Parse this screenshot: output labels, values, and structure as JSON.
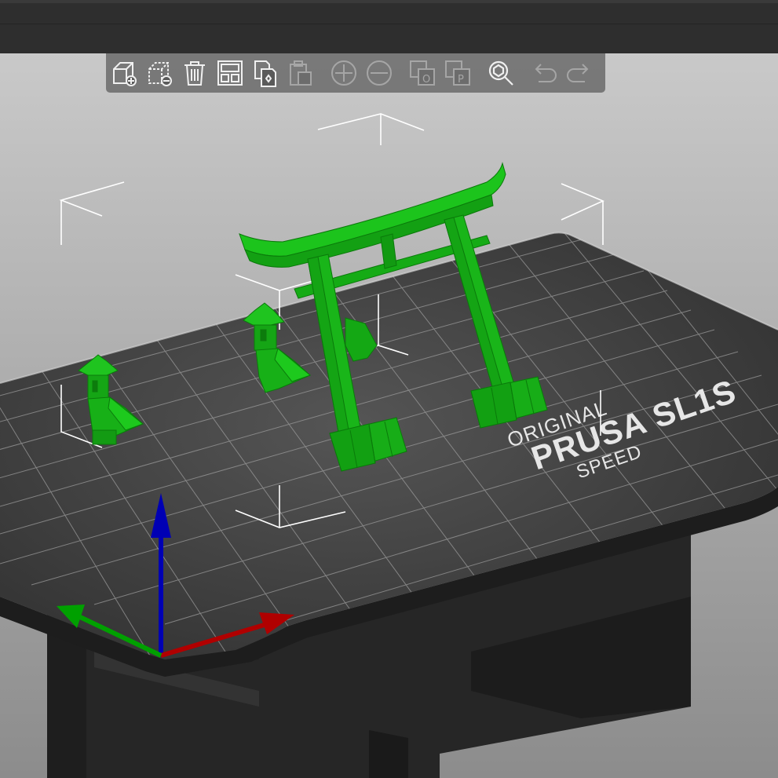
{
  "toolbar": {
    "buttons": [
      {
        "icon": "add-icon",
        "enabled": true
      },
      {
        "icon": "delete-icon",
        "enabled": true
      },
      {
        "icon": "delete-all-icon",
        "enabled": true
      },
      {
        "icon": "arrange-icon",
        "enabled": true
      },
      {
        "icon": "copy-icon",
        "enabled": true
      },
      {
        "icon": "paste-icon",
        "enabled": false
      },
      {
        "icon": "add-instance-icon",
        "enabled": false
      },
      {
        "icon": "remove-instance-icon",
        "enabled": false
      },
      {
        "icon": "split-to-objects-icon",
        "enabled": false
      },
      {
        "icon": "split-to-parts-icon",
        "enabled": false
      },
      {
        "icon": "search-icon",
        "enabled": true
      },
      {
        "icon": "undo-icon",
        "enabled": false
      },
      {
        "icon": "redo-icon",
        "enabled": false
      }
    ]
  },
  "bed": {
    "logo_line1": "ORIGINAL",
    "logo_line2": "PRUSA SL1S",
    "logo_line3": "SPEED"
  },
  "colors": {
    "background_top": "#c7c7c7",
    "background_bottom": "#8f8f8f",
    "topbar": "#2e2e2e",
    "bed": "#3a3a3a",
    "model": "#17b017",
    "axis_x": "#b00000",
    "axis_y": "#00a000",
    "axis_z": "#0000b4"
  }
}
